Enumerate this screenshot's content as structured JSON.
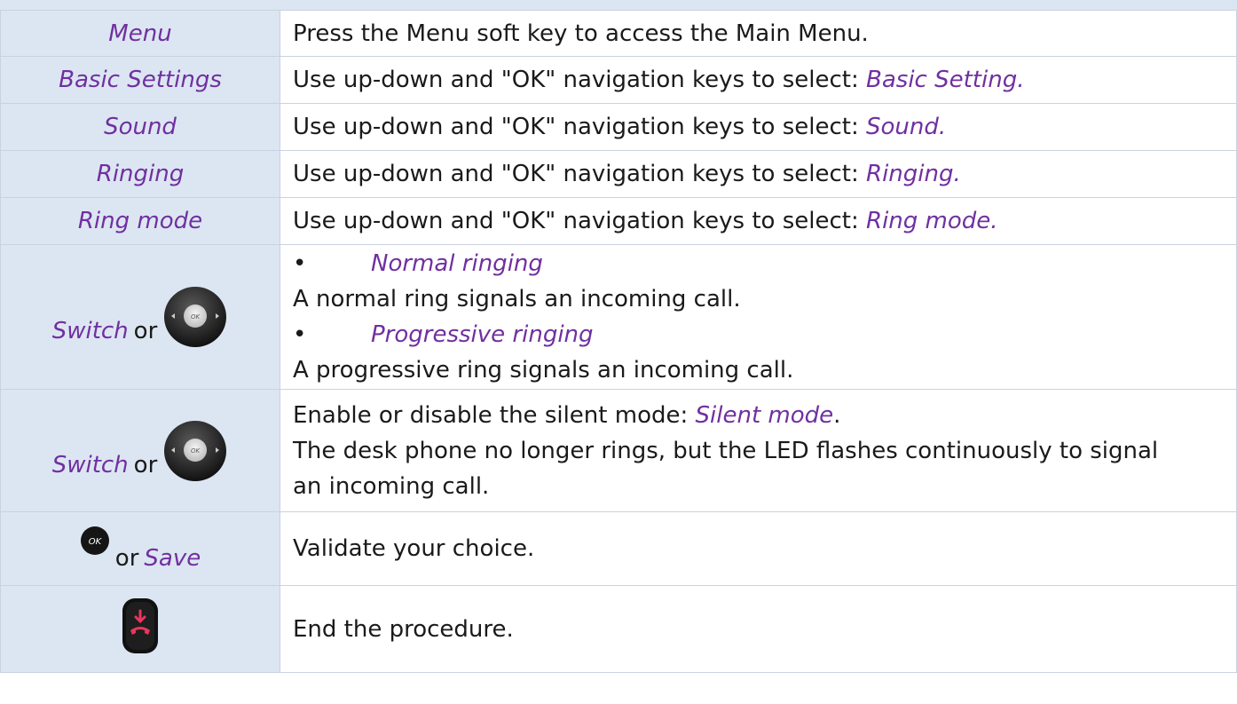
{
  "rows": [
    {
      "key": "Menu",
      "desc": "Press the Menu soft key to access the Main Menu."
    },
    {
      "key": "Basic Settings",
      "desc_prefix": "Use up-down and \"OK\" navigation keys to select: ",
      "desc_term": "Basic Setting."
    },
    {
      "key": "Sound",
      "desc_prefix": "Use up-down and \"OK\" navigation keys to select: ",
      "desc_term": "Sound."
    },
    {
      "key": "Ringing",
      "desc_prefix": "Use up-down and \"OK\" navigation keys to select: ",
      "desc_term": "Ringing."
    },
    {
      "key": "Ring mode",
      "desc_prefix": "Use up-down and \"OK\" navigation keys to select: ",
      "desc_term": "Ring mode."
    },
    {
      "key_word": "Switch",
      "key_or": "or",
      "bullets": [
        {
          "title": "Normal ringing",
          "text": "A normal ring signals an incoming call."
        },
        {
          "title": "Progressive ringing",
          "text": "A progressive ring signals an incoming call."
        }
      ],
      "bullet_char": "•",
      "icon": "navigation-pad-icon"
    },
    {
      "key_word": "Switch",
      "key_or": "or",
      "desc_prefix": "Enable or disable the silent mode: ",
      "desc_term": "Silent mode",
      "desc_term_end": ".",
      "desc_line2": "The desk phone no longer rings, but the LED flashes continuously to signal an incoming call.",
      "icon": "navigation-pad-icon"
    },
    {
      "key_or": "or",
      "key_word": "Save",
      "desc": "Validate your choice.",
      "icon": "ok-button-icon"
    },
    {
      "desc": "End the procedure.",
      "icon": "hang-up-key-icon"
    }
  ],
  "colors": {
    "key_bg": "#dce6f2",
    "accent_purple": "#7030a0",
    "hangup_red": "#e8365b",
    "text": "#1a1a1a"
  },
  "icons": {
    "nav_pad_label": "OK",
    "ok_button_label": "OK"
  }
}
